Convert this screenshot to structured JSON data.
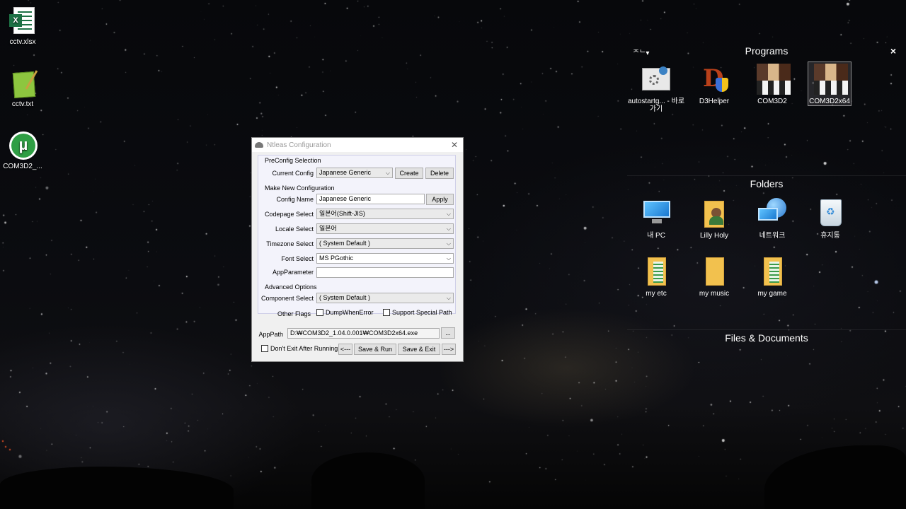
{
  "desktop_icons": [
    {
      "label": "cctv.xlsx",
      "icon": "excel-file-icon"
    },
    {
      "label": "cctv.txt",
      "icon": "notepad-file-icon"
    },
    {
      "label": "COM3D2_...",
      "icon": "utorrent-icon"
    }
  ],
  "panel": {
    "sort_label": "ᄌᄂ▾",
    "close_glyph": "×",
    "groups": [
      {
        "title": "Programs",
        "items": [
          {
            "label": "autostartg... - 바로 가기",
            "icon": "gear-shortcut-icon"
          },
          {
            "label": "D3Helper",
            "icon": "d3-shield-icon"
          },
          {
            "label": "COM3D2",
            "icon": "game-art-icon"
          },
          {
            "label": "COM3D2x64",
            "icon": "game-art-icon",
            "selected": true
          }
        ]
      },
      {
        "title": "Folders",
        "items": [
          {
            "label": "내 PC",
            "icon": "computer-icon"
          },
          {
            "label": "Lilly Holy",
            "icon": "user-folder-icon"
          },
          {
            "label": "네트워크",
            "icon": "network-icon"
          },
          {
            "label": "휴지통",
            "icon": "recycle-bin-icon"
          },
          {
            "label": "my etc",
            "icon": "folder-icon"
          },
          {
            "label": "my music",
            "icon": "folder-icon"
          },
          {
            "label": "my game",
            "icon": "folder-icon"
          }
        ]
      },
      {
        "title": "Files & Documents",
        "items": []
      }
    ]
  },
  "dialog": {
    "title": "Ntleas Configuration",
    "close_glyph": "✕",
    "preconfig": {
      "group_label": "PreConfig Selection",
      "current_config_label": "Current Config",
      "current_config_value": "Japanese Generic",
      "create_label": "Create",
      "delete_label": "Delete"
    },
    "make_new": {
      "group_label": "Make New Configuration",
      "config_name_label": "Config Name",
      "config_name_value": "Japanese Generic",
      "apply_label": "Apply",
      "codepage_label": "Codepage Select",
      "codepage_value": "일본어(Shift-JIS)",
      "locale_label": "Locale Select",
      "locale_value": "일본어",
      "timezone_label": "Timezone Select",
      "timezone_value": "( System Default )",
      "font_label": "Font Select",
      "font_value": "MS PGothic",
      "app_param_label": "AppParameter",
      "app_param_value": ""
    },
    "advanced": {
      "group_label": "Advanced Options",
      "component_label": "Component Select",
      "component_value": "( System Default )",
      "flags_label": "Other Flags",
      "dump_label": "DumpWhenError",
      "dump_checked": false,
      "special_path_label": "Support Special Path",
      "special_path_checked": false
    },
    "apppath_label": "AppPath",
    "apppath_value": "D:₩COM3D2_1.04.0.001₩COM3D2x64.exe",
    "browse_label": "...",
    "dont_exit_label": "Don't Exit After Running",
    "dont_exit_checked": false,
    "prev_label": "<---",
    "save_run_label": "Save & Run",
    "save_exit_label": "Save & Exit",
    "next_label": "--->"
  }
}
